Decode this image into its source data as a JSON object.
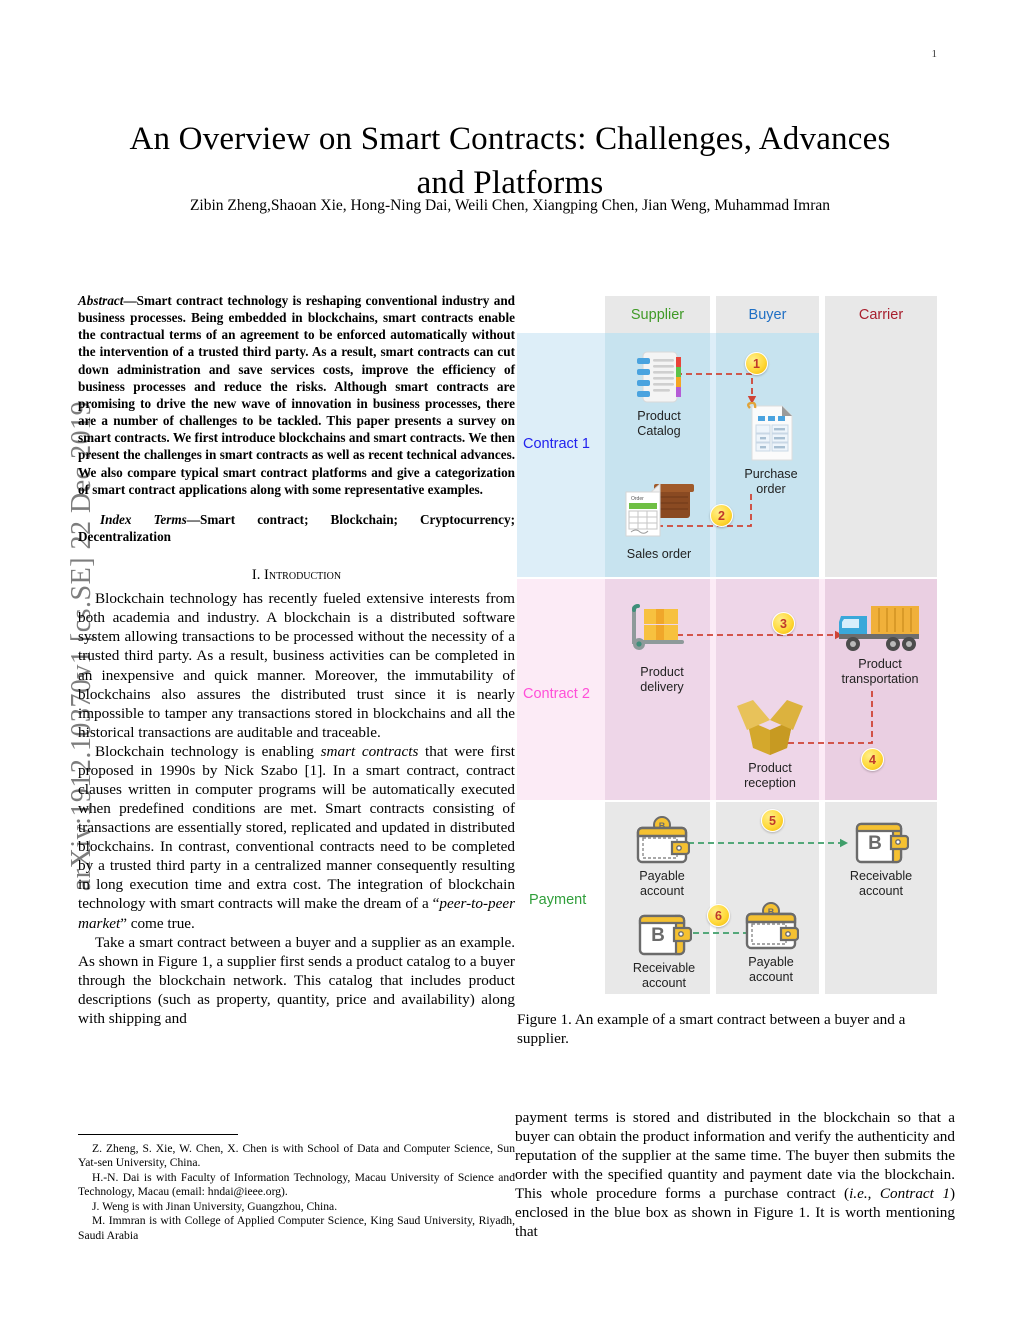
{
  "page": {
    "number": "1",
    "arxiv_stamp": "arXiv:1912.10370v1  [cs.SE]  22 Dec 2019"
  },
  "title": "An Overview on Smart Contracts: Challenges, Advances and Platforms",
  "authors": "Zibin Zheng,Shaoan Xie, Hong-Ning Dai, Weili Chen, Xiangping Chen, Jian Weng, Muhammad Imran",
  "abstract": {
    "lead": "Abstract",
    "dash": "—",
    "text": "Smart contract technology is reshaping conventional industry and business processes. Being embedded in blockchains, smart contracts enable the contractual terms of an agreement to be enforced automatically without the intervention of a trusted third party. As a result, smart contracts can cut down administration and save services costs, improve the efficiency of business processes and reduce the risks. Although smart contracts are promising to drive the new wave of innovation in business processes, there are a number of challenges to be tackled. This paper presents a survey on smart contracts. We first introduce blockchains and smart contracts. We then present the challenges in smart contracts as well as recent technical advances. We also compare typical smart contract platforms and give a categorization of smart contract applications along with some representative examples."
  },
  "index_terms": {
    "lead": "Index Terms",
    "dash": "—",
    "text": "Smart contract; Blockchain; Cryptocurrency; Decentralization"
  },
  "section": {
    "number": "I.",
    "title": "Introduction"
  },
  "paragraphs": {
    "p1": "Blockchain technology has recently fueled extensive interests from both academia and industry. A blockchain is a distributed software system allowing transactions to be processed without the necessity of a trusted third party. As a result, business activities can be completed in an inexpensive and quick manner. Moreover, the immutability of blockchains also assures the distributed trust since it is nearly impossible to tamper any transactions stored in blockchains and all the historical transactions are auditable and traceable.",
    "p2_a": "Blockchain technology is enabling ",
    "p2_i": "smart contracts",
    "p2_b": " that were first proposed in 1990s by Nick Szabo [1]. In a smart contract, contract clauses written in computer programs will be automatically executed when predefined conditions are met. Smart contracts consisting of transactions are essentially stored, replicated and updated in distributed blockchains. In contrast, conventional contracts need to be completed by a trusted third party in a centralized manner consequently resulting in long execution time and extra cost. The integration of blockchain technology with smart contracts will make the dream of a “",
    "p2_i2": "peer-to-peer market",
    "p2_c": "” come true.",
    "p3": "Take a smart contract between a buyer and a supplier as an example. As shown in Figure 1, a supplier first sends a product catalog to a buyer through the blockchain network. This catalog that includes product descriptions (such as property, quantity, price and availability) along with shipping and",
    "p4_a": "payment terms is stored and distributed in the blockchain so that a buyer can obtain the product information and verify the authenticity and reputation of the supplier at the same time. The buyer then submits the order with the specified quantity and payment date via the blockchain. This whole procedure forms a purchase contract (",
    "p4_i1": "i.e.",
    "p4_b": ", ",
    "p4_i2": "Contract 1",
    "p4_c": ") enclosed in the blue box as shown in Figure 1. It is worth mentioning that"
  },
  "affiliations": [
    "Z. Zheng, S. Xie, W. Chen, X. Chen is with School of Data and Computer Science, Sun Yat-sen University, China.",
    "H.-N. Dai is with Faculty of Information Technology, Macau University of Science and Technology, Macau (email: hndai@ieee.org).",
    "J. Weng is with Jinan University, Guangzhou, China.",
    "M. Immran is with College of Applied Computer Science, King Saud University, Riyadh, Saudi Arabia"
  ],
  "figure": {
    "caption": "Figure 1. An example of a smart contract between a buyer and a supplier.",
    "lanes": [
      {
        "key": "supplier",
        "label": "Supplier",
        "color": "#3f9a26"
      },
      {
        "key": "buyer",
        "label": "Buyer",
        "color": "#1f6fc4"
      },
      {
        "key": "carrier",
        "label": "Carrier",
        "color": "#a81f2e"
      }
    ],
    "groups": [
      {
        "key": "contract1",
        "label": "Contract 1",
        "color": "#2222ee"
      },
      {
        "key": "contract2",
        "label": "Contract 2",
        "color": "#ff4fd8"
      },
      {
        "key": "payment",
        "label": "Payment",
        "color": "#2f9e3a"
      }
    ],
    "nodes": [
      {
        "key": "product-catalog",
        "icon": "notebook-icon",
        "label_line1": "Product",
        "label_line2": "Catalog"
      },
      {
        "key": "purchase-order",
        "icon": "document-table-icon",
        "label_line1": "Purchase",
        "label_line2": "order"
      },
      {
        "key": "sales-order",
        "icon": "sales-order-icon",
        "label_line1": "Sales order",
        "label_line2": ""
      },
      {
        "key": "product-delivery",
        "icon": "handtruck-boxes-icon",
        "label_line1": "Product",
        "label_line2": "delivery"
      },
      {
        "key": "product-transportation",
        "icon": "truck-icon",
        "label_line1": "Product",
        "label_line2": "transportation"
      },
      {
        "key": "product-reception",
        "icon": "open-box-icon",
        "label_line1": "Product",
        "label_line2": "reception"
      },
      {
        "key": "payable-account-1",
        "icon": "wallet-coin-icon",
        "label_line1": "Payable",
        "label_line2": "account"
      },
      {
        "key": "receivable-account-1",
        "icon": "wallet-bitcoin-icon",
        "label_line1": "Receivable",
        "label_line2": "account"
      },
      {
        "key": "receivable-account-2",
        "icon": "wallet-bitcoin-icon",
        "label_line1": "Receivable",
        "label_line2": "account"
      },
      {
        "key": "payable-account-2",
        "icon": "wallet-coin-icon",
        "label_line1": "Payable",
        "label_line2": "account"
      }
    ],
    "steps": [
      "1",
      "2",
      "3",
      "4",
      "5",
      "6"
    ],
    "colors": {
      "contract1_band": "#c7e3ef",
      "contract1_outer": "#ddeef8",
      "contract2_band": "#eed6e8",
      "contract2_outer": "#fcebf6",
      "payment_band": "#e8e8e8",
      "arrow_red": "#cf4436",
      "arrow_green": "#3f9e6a",
      "badge": "#ffd93b"
    }
  }
}
